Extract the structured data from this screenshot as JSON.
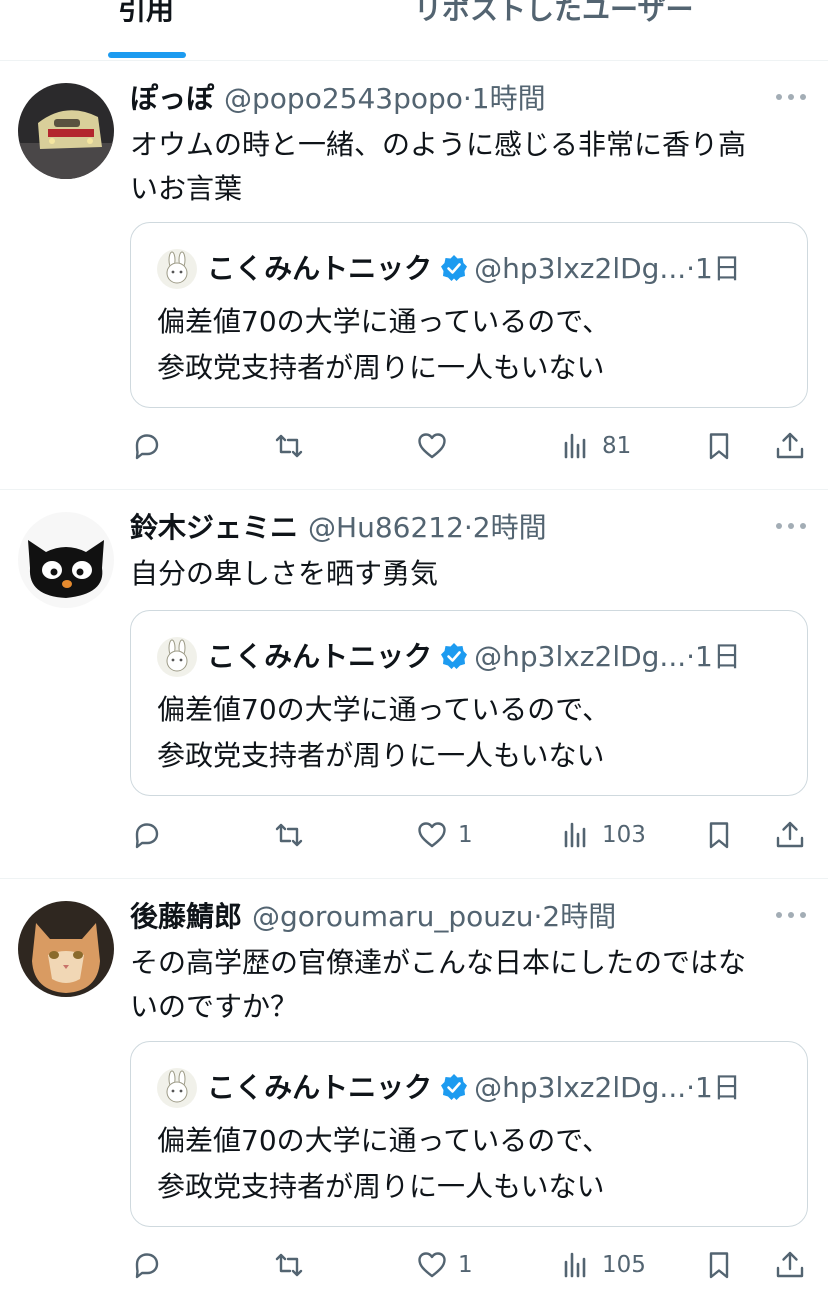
{
  "tabs": [
    {
      "label": "引用"
    },
    {
      "label": "リポストしたユーザー"
    }
  ],
  "posts": [
    {
      "name": "ぽっぽ",
      "handle": "@popo2543popo",
      "dot": "·",
      "time": "1時間",
      "lines": [
        "オウムの時と一緒、のように感じる非常に香り高",
        "いお言葉"
      ],
      "avatar": "train-photo",
      "quote": {
        "name": "こくみんトニック",
        "handle": "@hp3lxz2lDg...",
        "dot": "·",
        "time": "1日",
        "lines": [
          "偏差値70の大学に通っているので、",
          "参政党支持者が周りに一人もいない"
        ]
      },
      "stats": {
        "replies": "",
        "reposts": "",
        "likes": "",
        "views": "81"
      }
    },
    {
      "name": "鈴木ジェミニ",
      "handle": "@Hu86212",
      "dot": "·",
      "time": "2時間",
      "lines": [
        "自分の卑しさを晒す勇気"
      ],
      "avatar": "black-cat-illustration",
      "quote": {
        "name": "こくみんトニック",
        "handle": "@hp3lxz2lDg...",
        "dot": "·",
        "time": "1日",
        "lines": [
          "偏差値70の大学に通っているので、",
          "参政党支持者が周りに一人もいない"
        ]
      },
      "stats": {
        "replies": "",
        "reposts": "",
        "likes": "1",
        "views": "103"
      }
    },
    {
      "name": "後藤鯖郎",
      "handle": "@goroumaru_pouzu",
      "dot": "·",
      "time": "2時間",
      "lines": [
        "その高学歴の官僚達がこんな日本にしたのではな",
        "いのですか？"
      ],
      "avatar": "cat-photo",
      "quote": {
        "name": "こくみんトニック",
        "handle": "@hp3lxz2lDg...",
        "dot": "·",
        "time": "1日",
        "lines": [
          "偏差値70の大学に通っているので、",
          "参政党支持者が周りに一人もいない"
        ]
      },
      "stats": {
        "replies": "",
        "reposts": "",
        "likes": "1",
        "views": "105"
      }
    }
  ],
  "colors": {
    "accent": "#1d9bf0",
    "text": "#0f1419",
    "muted": "#536471",
    "border": "#cfd9de"
  },
  "icons": [
    "reply-icon",
    "repost-icon",
    "like-icon",
    "views-icon",
    "bookmark-icon",
    "share-icon",
    "more-icon",
    "verified-badge-icon"
  ]
}
